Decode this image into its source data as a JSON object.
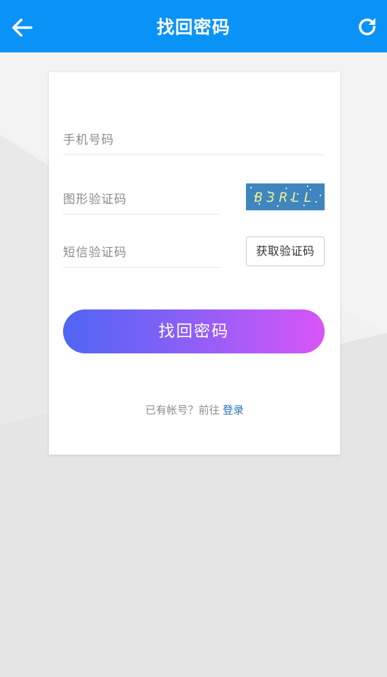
{
  "header": {
    "title": "找回密码",
    "back_icon": "back-arrow-icon",
    "refresh_icon": "refresh-icon",
    "bg_color": "#0a93f7"
  },
  "form": {
    "phone_placeholder": "手机号码",
    "captcha_placeholder": "图形验证码",
    "captcha_image_text": "B3RLL",
    "sms_placeholder": "短信验证码",
    "sms_button_label": "获取验证码",
    "submit_label": "找回密码"
  },
  "footer": {
    "prompt_text": "已有帐号？前往",
    "login_link": "登录"
  }
}
